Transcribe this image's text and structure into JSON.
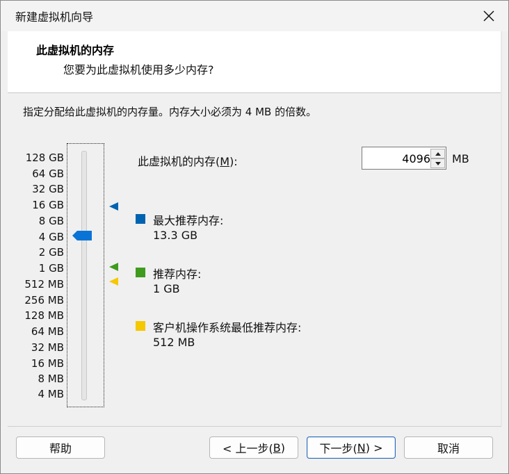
{
  "window": {
    "title": "新建虚拟机向导",
    "close_icon": "✕"
  },
  "header": {
    "title": "此虚拟机的内存",
    "subtitle": "您要为此虚拟机使用多少内存?"
  },
  "description": "指定分配给此虚拟机的内存量。内存大小必须为 4 MB 的倍数。",
  "scale": {
    "labels": [
      "128 GB",
      "64 GB",
      "32 GB",
      "16 GB",
      "8 GB",
      "4 GB",
      "2 GB",
      "1 GB",
      "512 MB",
      "256 MB",
      "128 MB",
      "64 MB",
      "32 MB",
      "16 MB",
      "8 MB",
      "4 MB"
    ],
    "selected": "4 GB"
  },
  "memory": {
    "label": "此虚拟机的内存(M):",
    "label_main": "此虚拟机的内存(",
    "label_key": "M",
    "label_end": "):",
    "value": "4096",
    "unit": "MB"
  },
  "legend": [
    {
      "label": "最大推荐内存:",
      "value": "13.3 GB",
      "color": "#0063b1"
    },
    {
      "label": "推荐内存:",
      "value": "1 GB",
      "color": "#3f9b1e"
    },
    {
      "label": "客户机操作系统最低推荐内存:",
      "value": "512 MB",
      "color": "#f5c800"
    }
  ],
  "buttons": {
    "help": "帮助",
    "back": {
      "pre": "< 上一步(",
      "key": "B",
      "post": ")"
    },
    "next": {
      "pre": "下一步(",
      "key": "N",
      "post": ") >"
    },
    "cancel": "取消"
  },
  "icons": {
    "close": "close-icon",
    "spin_up": "spin-up-icon",
    "spin_down": "spin-down-icon"
  }
}
